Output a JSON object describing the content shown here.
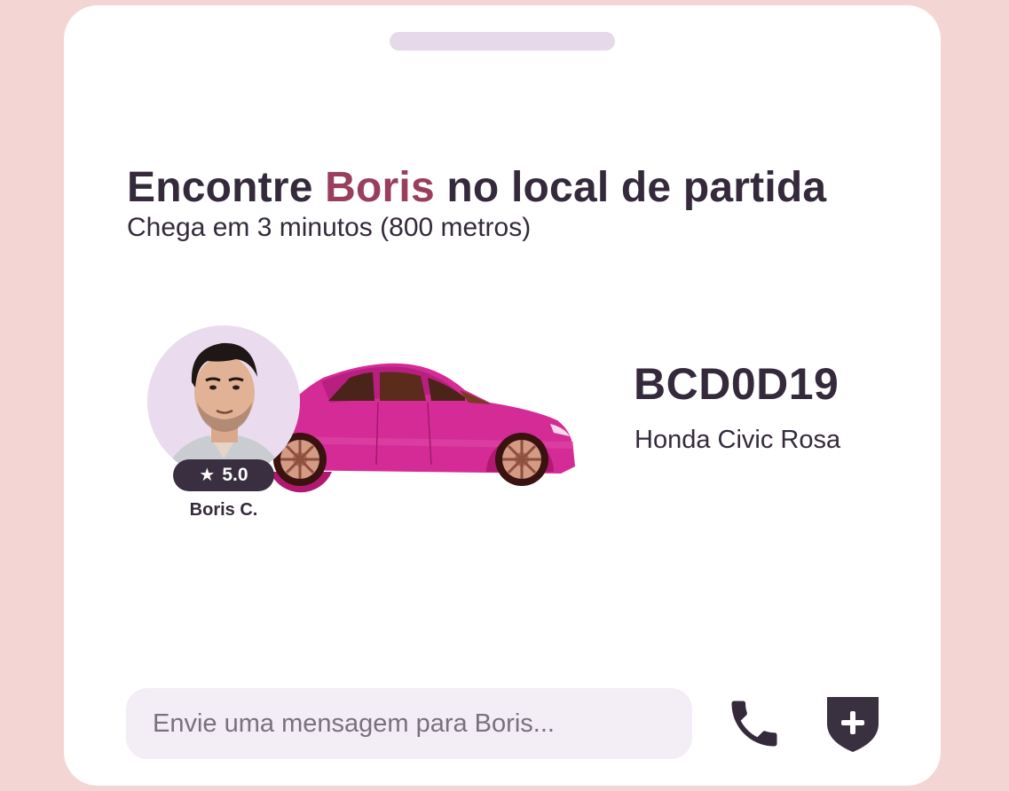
{
  "sheet": {
    "headline_prefix": "Encontre ",
    "driver_first_name": "Boris",
    "headline_suffix": " no local de partida",
    "subtitle": "Chega em 3 minutos (800 metros)"
  },
  "driver": {
    "rating": "5.0",
    "name": "Boris C.",
    "photo_icon": "driver-photo"
  },
  "vehicle": {
    "plate": "BCD0D19",
    "model": "Honda Civic Rosa",
    "color": "#d42b96"
  },
  "chat": {
    "placeholder": "Envie uma mensagem para Boris...",
    "value": ""
  },
  "actions": {
    "call_icon": "phone-icon",
    "safety_icon": "shield-plus-icon"
  },
  "colors": {
    "background": "#f3d6d4",
    "text": "#352a3b",
    "accent": "#9a3e5e",
    "input_bg": "#f3edf6",
    "handle": "#e5d9ea"
  }
}
